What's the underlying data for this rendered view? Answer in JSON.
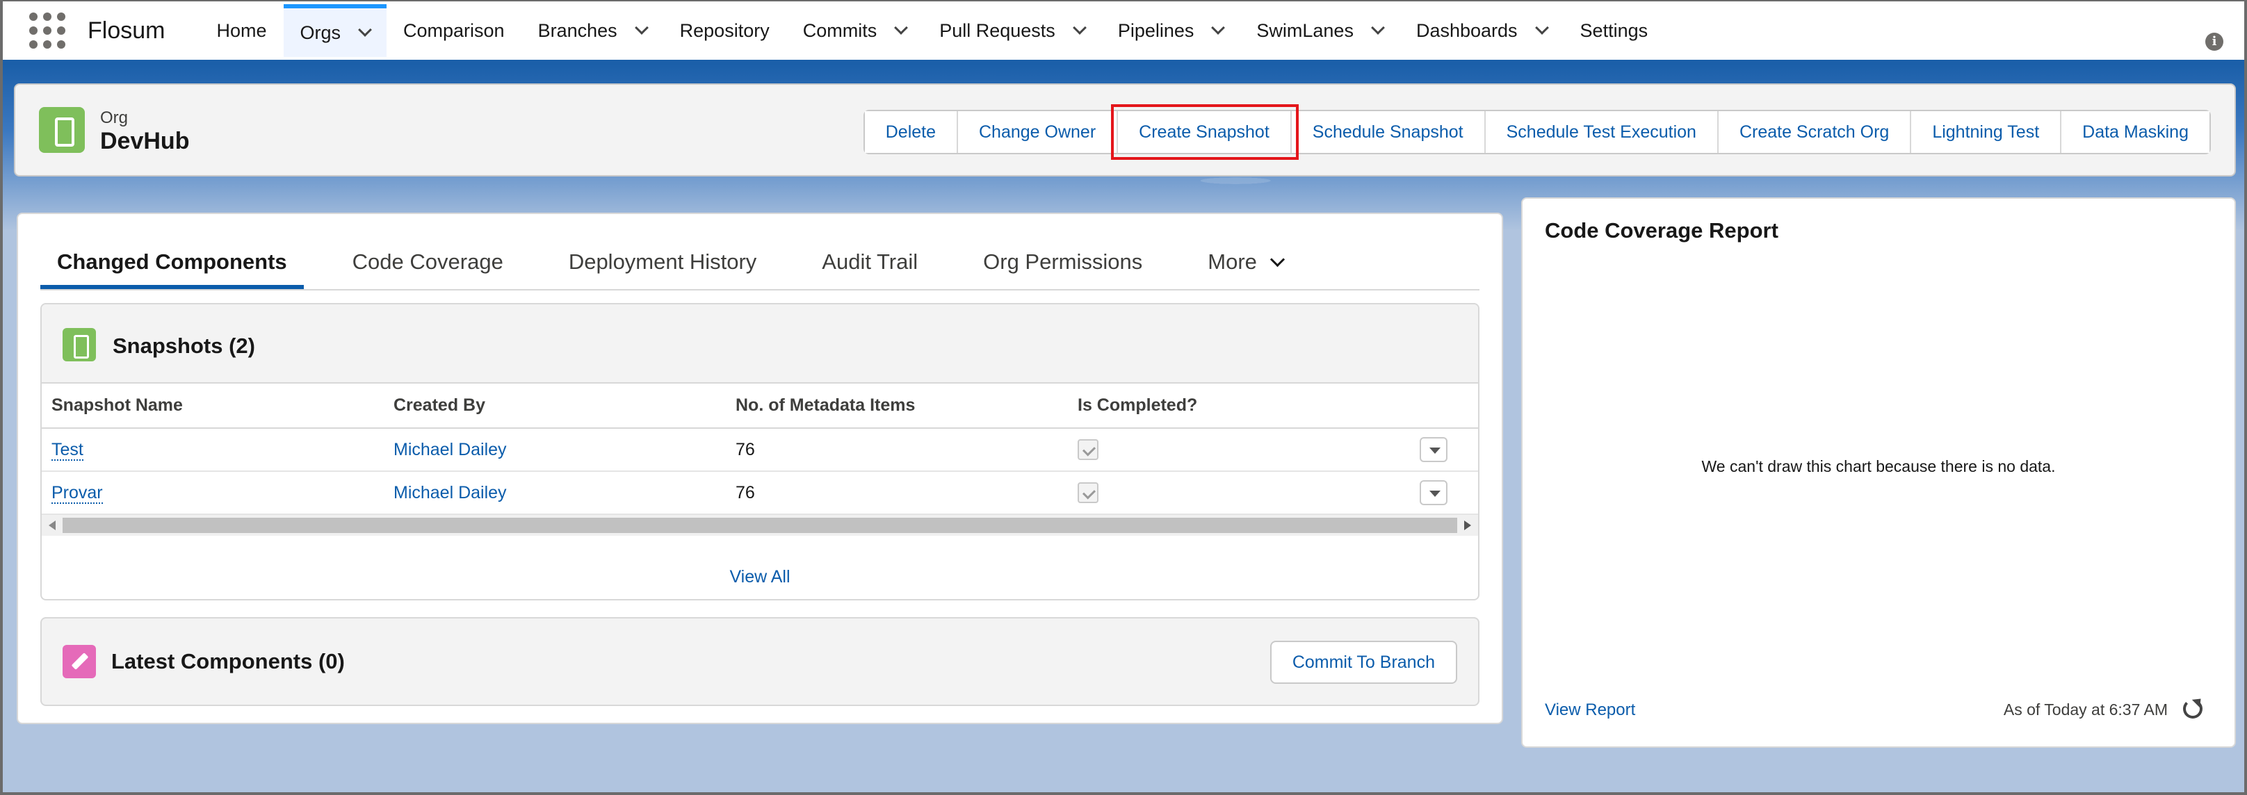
{
  "app": {
    "name": "Flosum"
  },
  "nav": {
    "items": [
      {
        "label": "Home",
        "has_menu": false,
        "active": false
      },
      {
        "label": "Orgs",
        "has_menu": true,
        "active": true
      },
      {
        "label": "Comparison",
        "has_menu": false,
        "active": false
      },
      {
        "label": "Branches",
        "has_menu": true,
        "active": false
      },
      {
        "label": "Repository",
        "has_menu": false,
        "active": false
      },
      {
        "label": "Commits",
        "has_menu": true,
        "active": false
      },
      {
        "label": "Pull Requests",
        "has_menu": true,
        "active": false
      },
      {
        "label": "Pipelines",
        "has_menu": true,
        "active": false
      },
      {
        "label": "SwimLanes",
        "has_menu": true,
        "active": false
      },
      {
        "label": "Dashboards",
        "has_menu": true,
        "active": false
      },
      {
        "label": "Settings",
        "has_menu": false,
        "active": false
      }
    ],
    "info_icon": "i"
  },
  "record": {
    "type": "Org",
    "name": "DevHub",
    "icon": "mobile-device-icon",
    "actions": [
      {
        "label": "Delete",
        "highlighted": false
      },
      {
        "label": "Change Owner",
        "highlighted": false
      },
      {
        "label": "Create Snapshot",
        "highlighted": true
      },
      {
        "label": "Schedule Snapshot",
        "highlighted": false
      },
      {
        "label": "Schedule Test Execution",
        "highlighted": false
      },
      {
        "label": "Create Scratch Org",
        "highlighted": false
      },
      {
        "label": "Lightning Test",
        "highlighted": false
      },
      {
        "label": "Data Masking",
        "highlighted": false
      }
    ]
  },
  "tabs": {
    "items": [
      "Changed Components",
      "Code Coverage",
      "Deployment History",
      "Audit Trail",
      "Org Permissions"
    ],
    "more_label": "More",
    "active_index": 0
  },
  "snapshots": {
    "title": "Snapshots (2)",
    "columns": [
      "Snapshot Name",
      "Created By",
      "No. of Metadata Items",
      "Is Completed?"
    ],
    "rows": [
      {
        "name": "Test",
        "created_by": "Michael Dailey",
        "items": "76",
        "completed": true
      },
      {
        "name": "Provar",
        "created_by": "Michael Dailey",
        "items": "76",
        "completed": true
      }
    ],
    "view_all": "View All"
  },
  "latest": {
    "title": "Latest Components (0)",
    "commit_label": "Commit To Branch"
  },
  "coverage_report": {
    "title": "Code Coverage Report",
    "empty_message": "We can't draw this chart because there is no data.",
    "view_report": "View Report",
    "as_of": "As of Today at 6:37 AM"
  },
  "colors": {
    "brand_blue": "#1b5fa9",
    "link": "#0b5cab",
    "highlight_red": "#e4161b",
    "org_icon_green": "#7fbf5b",
    "latest_icon_pink": "#e56ab9"
  }
}
